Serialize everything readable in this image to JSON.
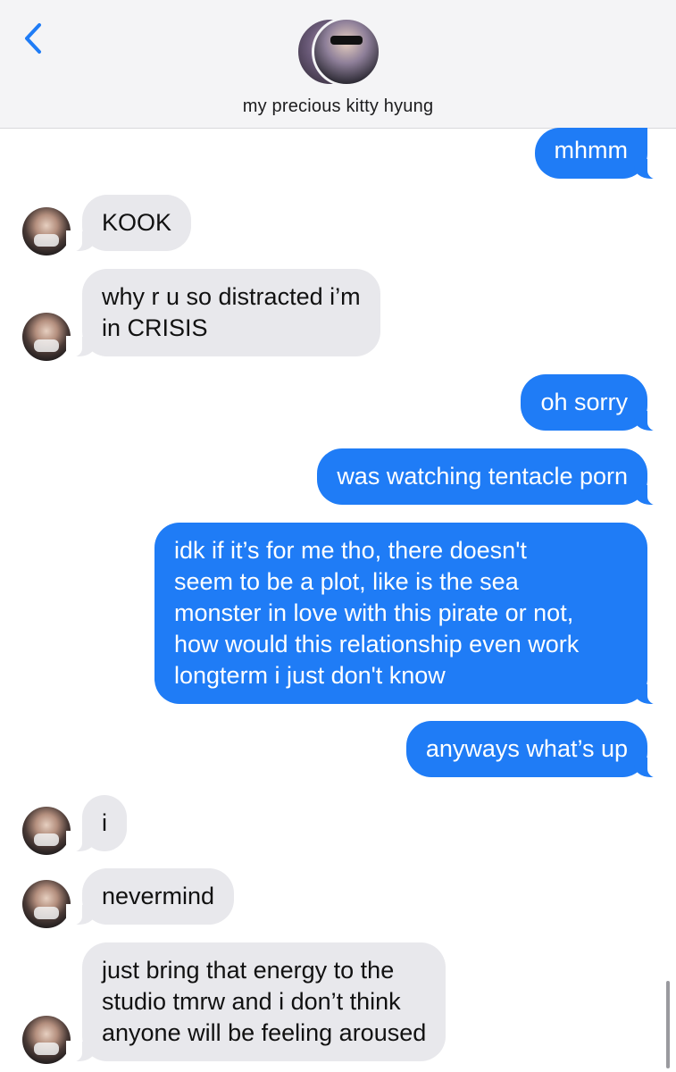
{
  "header": {
    "back_icon": "chevron-left-icon",
    "contact_name": "my precious kitty hyung",
    "accent": "#1f7cf6"
  },
  "messages": [
    {
      "from": "me",
      "text": "mhmm"
    },
    {
      "from": "them",
      "text": "KOOK"
    },
    {
      "from": "them",
      "text": "why r u so distracted i’m\nin CRISIS"
    },
    {
      "from": "me",
      "text": "oh sorry"
    },
    {
      "from": "me",
      "text": "was watching tentacle porn"
    },
    {
      "from": "me",
      "text": "idk if it’s for me tho, there doesn't\nseem to be a plot, like is the sea\nmonster in love with this pirate or not,\nhow would this relationship even work\nlongterm i just don't know"
    },
    {
      "from": "me",
      "text": "anyways what’s up"
    },
    {
      "from": "them",
      "text": "i"
    },
    {
      "from": "them",
      "text": "nevermind"
    },
    {
      "from": "them",
      "text": "just bring that energy to the\nstudio tmrw and i don’t think\nanyone will be feeling aroused"
    }
  ],
  "colors": {
    "sent_bubble": "#1f7cf6",
    "received_bubble": "#e8e8ec",
    "header_bg": "#f4f4f6"
  }
}
